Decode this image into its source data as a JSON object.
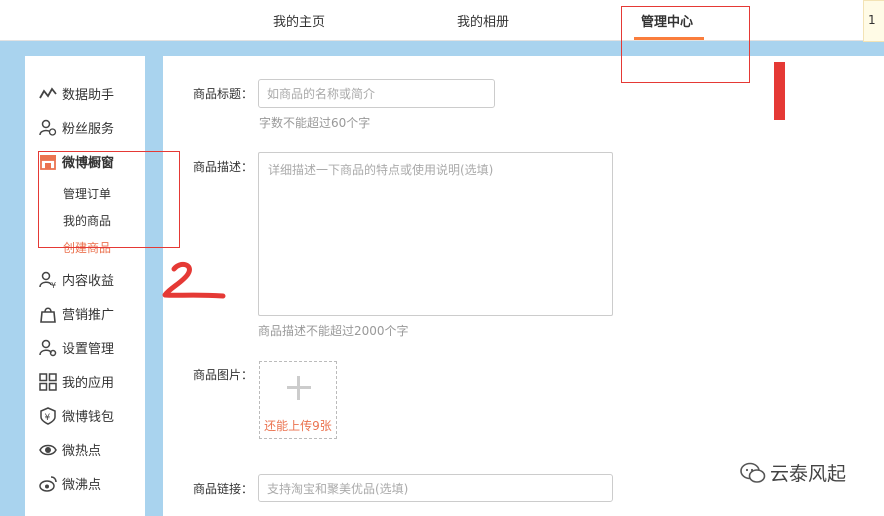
{
  "topnav": {
    "tabs": [
      {
        "label": "我的主页"
      },
      {
        "label": "我的相册"
      },
      {
        "label": "管理中心"
      }
    ],
    "corner_text": "1"
  },
  "sidebar": {
    "items": [
      {
        "label": "数据助手",
        "icon": "chart-line-icon"
      },
      {
        "label": "粉丝服务",
        "icon": "fans-icon"
      },
      {
        "label": "微博橱窗",
        "icon": "shop-window-icon"
      },
      {
        "label": "内容收益",
        "icon": "user-yen-icon"
      },
      {
        "label": "营销推广",
        "icon": "bag-icon"
      },
      {
        "label": "设置管理",
        "icon": "user-gear-icon"
      },
      {
        "label": "我的应用",
        "icon": "grid-icon"
      },
      {
        "label": "微博钱包",
        "icon": "wallet-icon"
      },
      {
        "label": "微热点",
        "icon": "eye-icon"
      },
      {
        "label": "微沸点",
        "icon": "weibo-icon"
      }
    ],
    "sub_items": [
      {
        "label": "管理订单"
      },
      {
        "label": "我的商品"
      },
      {
        "label": "创建商品"
      }
    ]
  },
  "form": {
    "title_label": "商品标题：",
    "title_placeholder": "如商品的名称或简介",
    "title_hint": "字数不能超过60个字",
    "desc_label": "商品描述：",
    "desc_placeholder": "详细描述一下商品的特点或使用说明(选填)",
    "desc_hint": "商品描述不能超过2000个字",
    "image_label": "商品图片：",
    "upload_text": "还能上传9张",
    "link_label": "商品链接：",
    "link_placeholder": "支持淘宝和聚美优品(选填)"
  },
  "annotations": {
    "number_mark": "2"
  },
  "watermark": {
    "text": "云泰风起",
    "icon": "wechat-icon"
  },
  "colors": {
    "accent": "#fa7d3c",
    "active_sub": "#eb7350",
    "annotation": "#e53935",
    "background": "#a9d3ee"
  }
}
